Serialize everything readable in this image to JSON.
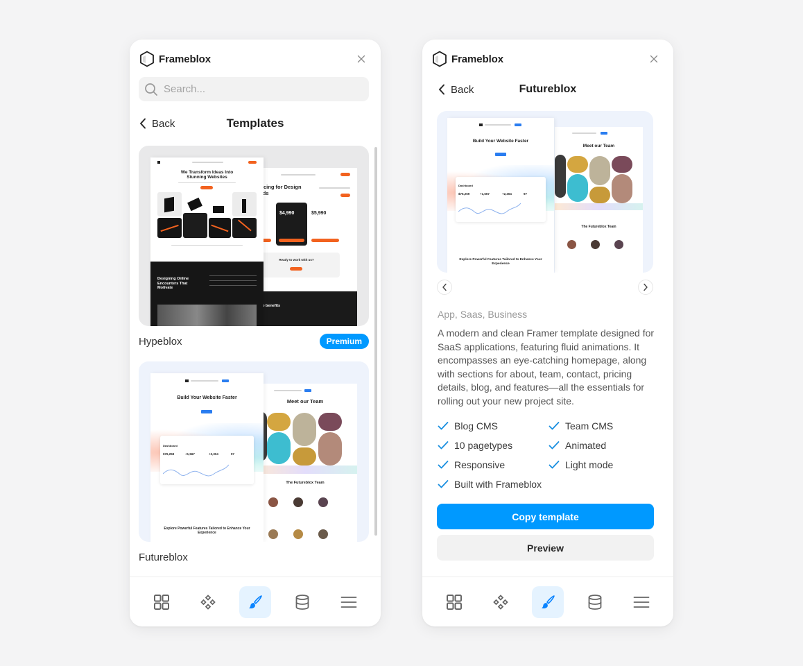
{
  "app": {
    "brand": "Frameblox"
  },
  "colors": {
    "accent": "#0099ff",
    "accent_soft": "#e5f3ff",
    "template_orange": "#f2621f"
  },
  "left_panel": {
    "search_placeholder": "Search...",
    "back_label": "Back",
    "title": "Templates",
    "templates": [
      {
        "name": "Hypeblox",
        "badge": "Premium",
        "preview": {
          "hero_title": "We Transform Ideas Into Stunning Websites",
          "pricing_title": "r Pricing for Design Needs",
          "price_a": "$4,990",
          "price_b": "$5,990",
          "cta_title": "Ready to work with us?",
          "dark_title": "Designing Online Encounters That Motivate",
          "benefits_title": "ership benefits"
        }
      },
      {
        "name": "Futureblox",
        "preview": {
          "hero_title": "Build Your Website Faster",
          "dashboard_label": "Dashboard",
          "stat_a": "$76,259",
          "stat_b": "+1,567",
          "stat_c": "+2,304",
          "stat_d": "97",
          "team_title": "Meet our Team",
          "team_sub": "The Futureblox Team",
          "features_title": "Explore Powerful Features Tailored to Enhance Your Experience"
        }
      }
    ]
  },
  "right_panel": {
    "back_label": "Back",
    "title": "Futureblox",
    "tags": "App, Saas, Business",
    "description": "A modern and clean Framer template designed for SaaS applications, featuring fluid animations. It encompasses an eye-catching homepage, along with sections for about, team, contact, pricing details, blog, and features—all the essentials for rolling out your new project site.",
    "features": [
      "Blog CMS",
      "Team CMS",
      "10 pagetypes",
      "Animated",
      "Responsive",
      "Light mode",
      "Built with Frameblox"
    ],
    "copy_label": "Copy template",
    "preview_label": "Preview"
  },
  "bottom_nav": {
    "items": [
      {
        "icon": "grid-icon",
        "active": false
      },
      {
        "icon": "components-icon",
        "active": false
      },
      {
        "icon": "brush-icon",
        "active": true
      },
      {
        "icon": "database-icon",
        "active": false
      },
      {
        "icon": "menu-icon",
        "active": false
      }
    ]
  }
}
